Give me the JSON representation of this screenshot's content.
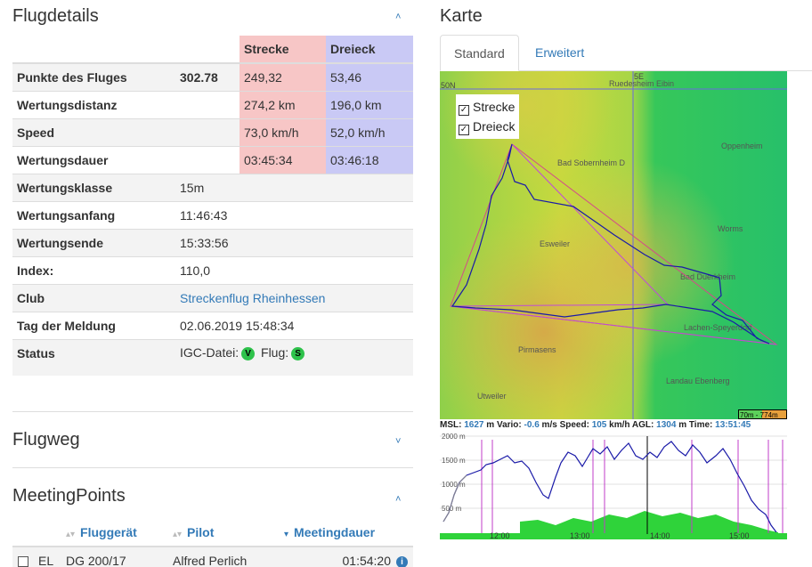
{
  "flugdetails": {
    "title": "Flugdetails",
    "columns": {
      "strecke": "Strecke",
      "dreieck": "Dreieck"
    },
    "score_rows": [
      {
        "label": "Punkte des Fluges",
        "total": "302.78",
        "strecke": "249,32",
        "dreieck": "53,46"
      },
      {
        "label": "Wertungsdistanz",
        "total": "",
        "strecke": "274,2 km",
        "dreieck": "196,0 km"
      },
      {
        "label": "Speed",
        "total": "",
        "strecke": "73,0 km/h",
        "dreieck": "52,0 km/h"
      },
      {
        "label": "Wertungsdauer",
        "total": "",
        "strecke": "03:45:34",
        "dreieck": "03:46:18"
      }
    ],
    "info_rows": [
      {
        "label": "Wertungsklasse",
        "value": "15m"
      },
      {
        "label": "Wertungsanfang",
        "value": "11:46:43"
      },
      {
        "label": "Wertungsende",
        "value": "15:33:56"
      },
      {
        "label": "Index:",
        "value": "110,0"
      },
      {
        "label": "Club",
        "value": "Streckenflug Rheinhessen",
        "link": true
      },
      {
        "label": "Tag der Meldung",
        "value": "02.06.2019 15:48:34"
      }
    ],
    "status": {
      "label": "Status",
      "igc": "IGC-Datei:",
      "igc_badge": "V",
      "flug": "Flug:",
      "flug_badge": "S"
    }
  },
  "flugweg": {
    "title": "Flugweg"
  },
  "meeting": {
    "title": "MeetingPoints",
    "headers": {
      "geraet": "Fluggerät",
      "pilot": "Pilot",
      "dauer": "Meetingdauer"
    },
    "rows": [
      {
        "kenn": "EL",
        "geraet": "DG 200/17",
        "pilot": "Alfred Perlich",
        "dauer": "01:54:20"
      }
    ]
  },
  "karte": {
    "title": "Karte",
    "tabs": [
      "Standard",
      "Erweitert"
    ],
    "legend": [
      "Strecke",
      "Dreieck"
    ],
    "places": [
      "Ruedesheim Eibin",
      "Bad Sobernheim D",
      "Oppenheim",
      "Worms",
      "Esweiler",
      "Bad Duerkheim",
      "Lachen-Speyerdorf",
      "Pirmasens",
      "Landau Ebenberg",
      "Utweiler"
    ],
    "grid_labels": [
      "5E",
      "50N"
    ],
    "scale": "70m - 774m"
  },
  "baro": {
    "msl_label": "MSL:",
    "msl": "1627",
    "msl_unit": "m",
    "vario_label": "Vario:",
    "vario": "-0.6",
    "vario_unit": "m/s",
    "speed_label": "Speed:",
    "speed": "105",
    "speed_unit": "km/h",
    "agl_label": "AGL:",
    "agl": "1304",
    "agl_unit": "m",
    "time_label": "Time:",
    "time": "13:51:45",
    "y_ticks": [
      "2000 m",
      "1500 m",
      "1000 m",
      "500 m"
    ],
    "x_ticks": [
      "12:00",
      "13:00",
      "14:00",
      "15:00"
    ]
  },
  "colors": {
    "accent": "#337ab7",
    "strecke": "#f7c6c6",
    "dreieck": "#c9c9f5"
  }
}
